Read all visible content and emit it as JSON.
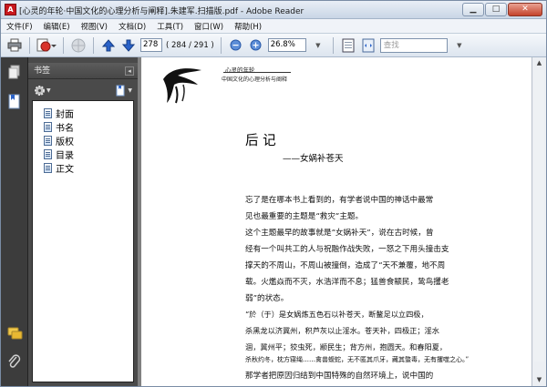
{
  "window": {
    "title": "[心灵的年轮·中国文化的心理分析与阐释].朱建军.扫描版.pdf - Adobe Reader",
    "app_icon": "pdf-icon",
    "minimize_icon": "minimize-icon",
    "maximize_icon": "maximize-icon",
    "close_icon": "close-icon"
  },
  "menubar": {
    "items": [
      "文件(F)",
      "编辑(E)",
      "视图(V)",
      "文档(D)",
      "工具(T)",
      "窗口(W)",
      "帮助(H)"
    ]
  },
  "toolbar": {
    "current_page": "278",
    "page_count": "( 284 / 291 )",
    "zoom": "26.8%",
    "find_placeholder": "查找"
  },
  "panel": {
    "title": "书签",
    "bookmarks": [
      "封面",
      "书名",
      "版权",
      "目录",
      "正文"
    ]
  },
  "document": {
    "header_line1": "心灵的年轮",
    "header_line2": "中国文化的心理分析与阐释",
    "title": "后 记",
    "subtitle": "——女娲补苍天",
    "paragraphs": [
      "  忘了是在哪本书上看到的，有学者说中国的神话中最常",
      "见也最重要的主题是“救灾”主题。",
      "  这个主题最早的故事就是“女娲补天”，说在古时候，曾",
      "经有一个叫共工的人与祝融作战失败，一怒之下用头撞击支",
      "撑天的不周山，不周山被撞倒，造成了“天不兼覆，地不周",
      "载。火爁焱而不灭，水浩洋而不息；猛兽食颛民，鸷鸟攫老",
      "弱”的状态。",
      "  “於（于）是女娲炼五色石以补苍天，断鳌足以立四极，",
      "杀黑龙以济冀州，积芦灰以止淫水。苍天补，四极正；淫水",
      "涸，冀州平；狡虫死，颛民生；背方州，抱圆天。和春阳夏，",
      "杀秋约冬，枕方寝绳……禽兽蝮蛇，无不匿其爪牙，藏其螫毒，无有攫噬之心。”",
      "  那学者把原因归结到中国特殊的自然环境上，说中国的"
    ]
  },
  "colors": {
    "title_bar": "#d3deeb",
    "panel_bg": "#4a4a4a",
    "viewer_bg": "#808080",
    "accent_blue": "#2a62c9"
  }
}
